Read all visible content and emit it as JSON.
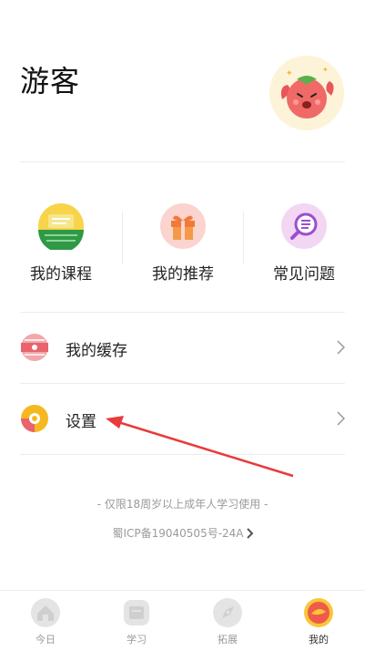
{
  "profile": {
    "username": "游客",
    "avatar_icon": "tomato-mascot-avatar"
  },
  "quick_links": [
    {
      "label": "我的课程",
      "icon": "book-icon",
      "color": "#3a9a3a"
    },
    {
      "label": "我的推荐",
      "icon": "gift-icon",
      "color": "#f07a3a"
    },
    {
      "label": "常见问题",
      "icon": "search-question-icon",
      "color": "#9b4fcf"
    }
  ],
  "menu": [
    {
      "label": "我的缓存",
      "icon": "cache-icon",
      "color": "#e8636d"
    },
    {
      "label": "设置",
      "icon": "settings-gear-icon",
      "color": "#f5b820"
    }
  ],
  "footer": {
    "age_notice": "- 仅限18周岁以上成年人学习使用 -",
    "icp": "蜀ICP备19040505号-24A"
  },
  "tabbar": [
    {
      "label": "今日",
      "icon": "home-icon",
      "active": false
    },
    {
      "label": "学习",
      "icon": "study-icon",
      "active": false
    },
    {
      "label": "拓展",
      "icon": "explore-icon",
      "active": false
    },
    {
      "label": "我的",
      "icon": "profile-icon",
      "active": true
    }
  ],
  "colors": {
    "accent": "#e83b3b",
    "muted_text": "#9a9a9a",
    "divider": "#ececec"
  }
}
